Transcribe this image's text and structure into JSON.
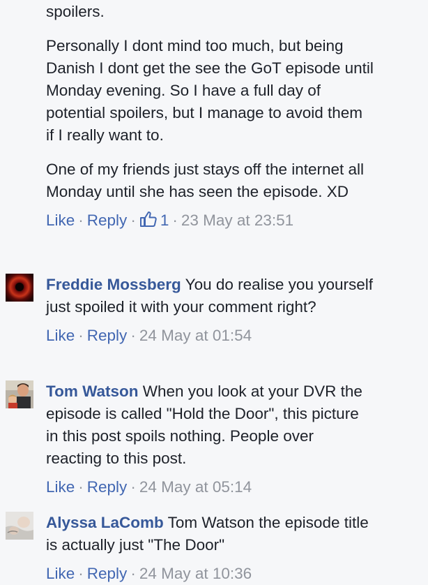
{
  "top_comment": {
    "paragraphs": [
      "spoilers.",
      "Personally I dont mind too much, but being Danish I dont get the see the GoT episode until Monday evening. So I have a full day of potential spoilers, but I manage to avoid them if I really want to.",
      "One of my friends just stays off the internet all Monday until she has seen the episode. XD"
    ],
    "like_label": "Like",
    "reply_label": "Reply",
    "likes_count": "1",
    "timestamp": "23 May at 23:51"
  },
  "comments": [
    {
      "name": "Freddie Mossberg",
      "text": "You do realise you yourself just spoiled it with your comment right?",
      "like_label": "Like",
      "reply_label": "Reply",
      "timestamp": "24 May at 01:54"
    },
    {
      "name": "Tom Watson",
      "text": "When you look at your DVR the episode is called \"Hold the Door\", this picture in this post spoils nothing. People over reacting to this post.",
      "like_label": "Like",
      "reply_label": "Reply",
      "timestamp": "24 May at 05:14"
    },
    {
      "name": "Alyssa LaComb",
      "text": "Tom Watson the episode title is actually just \"The Door\"",
      "like_label": "Like",
      "reply_label": "Reply",
      "timestamp": "24 May at 10:36"
    }
  ],
  "colors": {
    "link": "#4267b2",
    "name": "#365899",
    "meta": "#90949c",
    "text": "#1d2129",
    "background": "#f6f7f9"
  }
}
